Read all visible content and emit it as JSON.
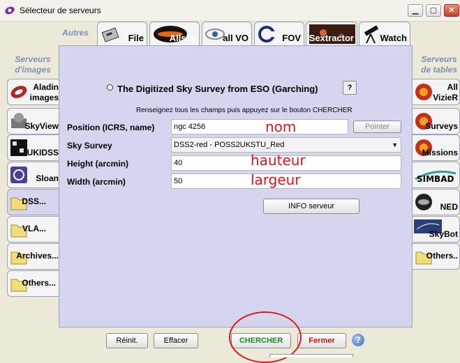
{
  "window": {
    "title": "Sélecteur de serveurs"
  },
  "sections": {
    "autres": "Autres",
    "serveurs_images": "Serveurs\nd'images",
    "serveurs_tables": "Serveurs\nde tables"
  },
  "top_tabs": [
    {
      "label": "File",
      "icon": "file-drawer-icon"
    },
    {
      "label": "Allsky",
      "icon": "allsky-icon"
    },
    {
      "label": "all VO",
      "icon": "vo-icon"
    },
    {
      "label": "FOV",
      "icon": "fov-icon"
    },
    {
      "label": "Sextractor",
      "icon": "sextractor-icon"
    },
    {
      "label": "Watch",
      "icon": "telescope-icon"
    }
  ],
  "left_tabs": [
    {
      "label": "Aladin\nimages",
      "icon": "aladin-icon"
    },
    {
      "label": "SkyView",
      "icon": "skyview-icon"
    },
    {
      "label": "UKIDSS",
      "icon": "ukidss-icon"
    },
    {
      "label": "Sloan",
      "icon": "sloan-icon"
    },
    {
      "label": "DSS...",
      "icon": "folder-icon",
      "active": true
    },
    {
      "label": "VLA...",
      "icon": "folder-icon"
    },
    {
      "label": "Archives...",
      "icon": "folder-icon"
    },
    {
      "label": "Others...",
      "icon": "folder-icon"
    }
  ],
  "right_tabs": [
    {
      "label": "All\nVizieR",
      "icon": "vizier-icon"
    },
    {
      "label": "Surveys",
      "icon": "surveys-icon"
    },
    {
      "label": "Missions",
      "icon": "missions-icon"
    },
    {
      "label": "",
      "icon": "simbad-logo-icon",
      "logo_text": "SIMBAD"
    },
    {
      "label": "NED",
      "icon": "ned-icon"
    },
    {
      "label": "SkyBot",
      "icon": "skybot-icon"
    },
    {
      "label": "Others..",
      "icon": "folder-icon"
    }
  ],
  "form": {
    "survey_title": "The Digitized Sky Survey from ESO (Garching)",
    "help_label": "?",
    "instruction": "Renseignez tous les champs puis appuyez sur le bouton CHERCHER",
    "position_label": "Position (ICRS, name)",
    "position_value": "ngc 4256",
    "pointer_label": "Pointer",
    "survey_label": "Sky Survey",
    "survey_value": "DSS2-red - POSS2UKSTU_Red",
    "height_label": "Height (arcmin)",
    "height_value": "40",
    "width_label": "Width (arcmin)",
    "width_value": "50",
    "info_label": "INFO serveur"
  },
  "annotations": {
    "nom": "nom",
    "hauteur": "hauteur",
    "largeur": "largeur"
  },
  "buttons": {
    "reinit": "Réinit.",
    "effacer": "Effacer",
    "chercher": "CHERCHER",
    "fermer": "Fermer",
    "help": "?"
  },
  "colors": {
    "chercher_text": "#1a8a2a",
    "fermer_text": "#cc1111",
    "annotation": "#e0141b",
    "panel_bg": "#d6d5f0",
    "section_title": "#7f8fb5"
  }
}
